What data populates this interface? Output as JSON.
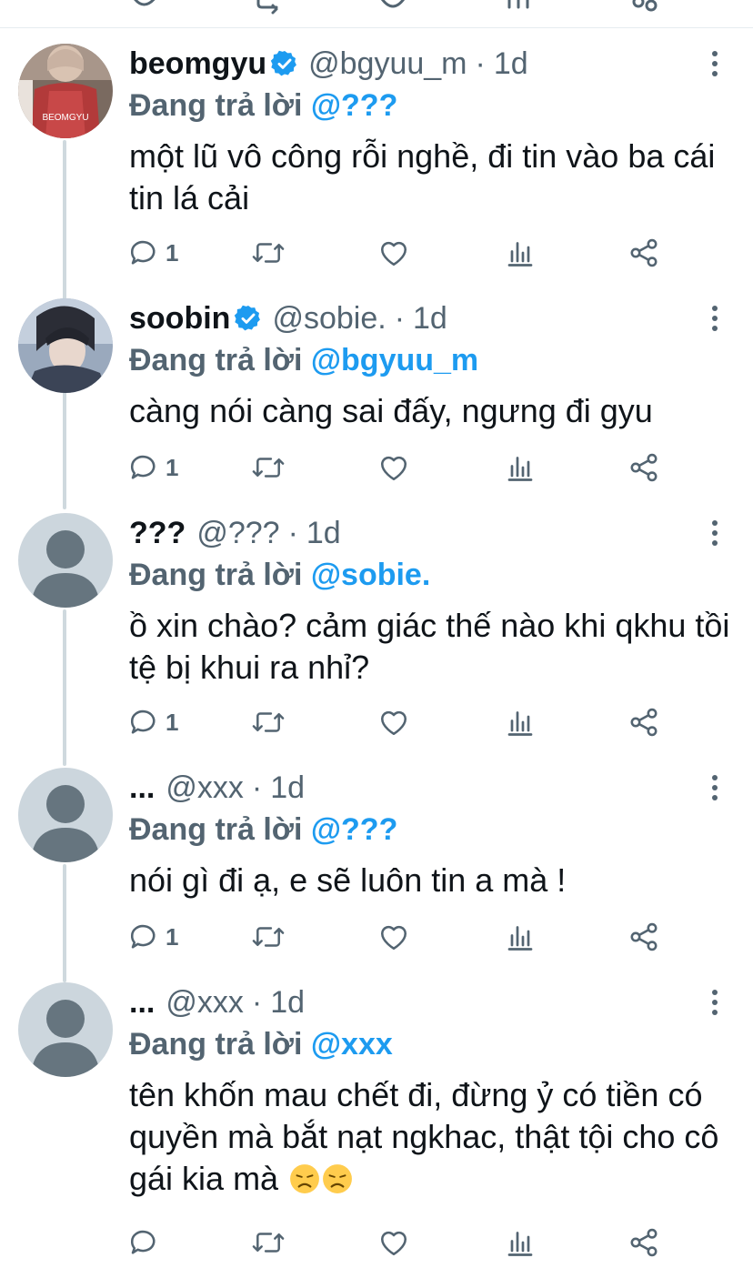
{
  "colors": {
    "accent": "#1d9bf0",
    "muted": "#536471",
    "text": "#0f1419",
    "thread_line": "#cfd9de"
  },
  "tweets": [
    {
      "name": "beomgyu",
      "verified": true,
      "handle": "@bgyuu_m",
      "time": "1d",
      "reply_prefix": "Đang trả lời",
      "reply_to": "@???",
      "text": "một lũ vô công rỗi nghề, đi tin vào ba cái tin lá cải",
      "reply_count": "1",
      "avatar_jersey_text": "BEOMGYU"
    },
    {
      "name": "soobin",
      "verified": true,
      "handle": "@sobie.",
      "time": "1d",
      "reply_prefix": "Đang trả lời",
      "reply_to": "@bgyuu_m",
      "text": "càng nói càng sai đấy, ngưng đi gyu",
      "reply_count": "1"
    },
    {
      "name": "???",
      "verified": false,
      "handle": "@???",
      "time": "1d",
      "reply_prefix": "Đang trả lời",
      "reply_to": "@sobie.",
      "text": "ồ xin chào? cảm giác thế nào khi qkhu tồi tệ bị khui ra nhỉ?",
      "reply_count": "1"
    },
    {
      "name": "...",
      "verified": false,
      "handle": "@xxx",
      "time": "1d",
      "reply_prefix": "Đang trả lời",
      "reply_to": "@???",
      "text": "nói gì đi ạ, e sẽ luôn tin a mà !",
      "reply_count": "1"
    },
    {
      "name": "...",
      "verified": false,
      "handle": "@xxx",
      "time": "1d",
      "reply_prefix": "Đang trả lời",
      "reply_to": "@xxx",
      "text": "tên khốn mau chết đi, đừng ỷ có tiền có quyền mà bắt nạt ngkhac, thật tội cho cô gái kia mà",
      "emoji": [
        "disappointed-face-emoji",
        "disappointed-face-emoji"
      ],
      "reply_count": ""
    }
  ],
  "icons": {
    "reply": "reply-icon",
    "retweet": "retweet-icon",
    "like": "heart-icon",
    "views": "analytics-icon",
    "share": "share-icon",
    "more": "more-icon",
    "verified": "verified-badge-icon"
  }
}
